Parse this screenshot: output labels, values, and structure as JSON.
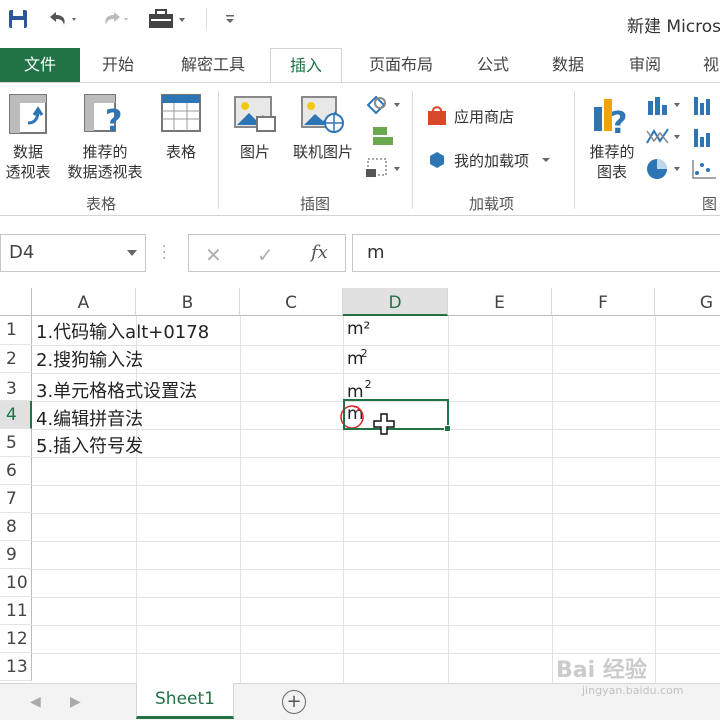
{
  "window": {
    "title": "新建 Micros"
  },
  "quick_access": {
    "save_icon": "save-icon",
    "undo_icon": "undo-icon",
    "redo_icon": "redo-icon",
    "toolbox_icon": "toolbox-icon",
    "customize_icon": "customize-qat-icon"
  },
  "tabs": [
    {
      "label": "文件"
    },
    {
      "label": "开始"
    },
    {
      "label": "解密工具"
    },
    {
      "label": "插入"
    },
    {
      "label": "页面布局"
    },
    {
      "label": "公式"
    },
    {
      "label": "数据"
    },
    {
      "label": "审阅"
    },
    {
      "label": "视"
    }
  ],
  "ribbon": {
    "tables_group": {
      "label": "表格",
      "pivot_label_1": "数据",
      "pivot_label_2": "透视表",
      "recommended_pivot_label_1": "推荐的",
      "recommended_pivot_label_2": "数据透视表",
      "table_label": "表格"
    },
    "illustrations_group": {
      "label": "插图",
      "picture_label": "图片",
      "online_picture_label": "联机图片"
    },
    "addins_group": {
      "label": "加载项",
      "store_label": "应用商店",
      "my_addins_label": "我的加载项"
    },
    "charts_group": {
      "label": "图",
      "recommended_charts_label_1": "推荐的",
      "recommended_charts_label_2": "图表"
    }
  },
  "formula_bar": {
    "name_box": "D4",
    "cancel_symbol": "✕",
    "enter_symbol": "✓",
    "fx_label": "fx",
    "content": "m"
  },
  "grid": {
    "columns": [
      "A",
      "B",
      "C",
      "D",
      "E",
      "F",
      "G"
    ],
    "selected_column": "D",
    "rows": [
      "1",
      "2",
      "3",
      "4",
      "5",
      "6",
      "7",
      "8",
      "9",
      "10",
      "11",
      "12",
      "13"
    ],
    "selected_row": "4",
    "cells": {
      "A1": "1.代码输入alt+0178",
      "A2": "2.搜狗输入法",
      "A3": "3.单元格格式设置法",
      "A4": "4.编辑拼音法",
      "A5": "5.插入符号发",
      "D1": "m²",
      "D2_base": "m",
      "D2_sup": "2",
      "D3_base": "m",
      "D3_sup": "2",
      "D4": "m"
    }
  },
  "sheets": {
    "active": "Sheet1",
    "add_label": "+"
  },
  "watermark": {
    "text": "Bai 经验",
    "sub": "jingyan.baidu.com"
  },
  "colors": {
    "accent": "#217346",
    "annotation": "#d8262c"
  }
}
